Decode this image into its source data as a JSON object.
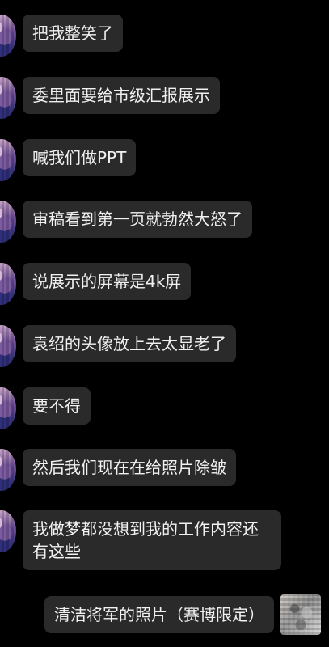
{
  "messages": [
    {
      "text": "把我整笑了",
      "side": "left"
    },
    {
      "text": "委里面要给市级汇报展示",
      "side": "left"
    },
    {
      "text": "喊我们做PPT",
      "side": "left"
    },
    {
      "text": "审稿看到第一页就勃然大怒了",
      "side": "left"
    },
    {
      "text": "说展示的屏幕是4k屏",
      "side": "left"
    },
    {
      "text": "袁绍的头像放上去太显老了",
      "side": "left"
    },
    {
      "text": "要不得",
      "side": "left"
    },
    {
      "text": "然后我们现在在给照片除皱",
      "side": "left"
    },
    {
      "text": "我做梦都没想到我的工作内容还有这些",
      "side": "left"
    },
    {
      "text": "清洁将军的照片（赛博限定）",
      "side": "right"
    }
  ],
  "colors": {
    "background": "#000000",
    "bubble": "#2a2a2a",
    "text": "#f1f1f1"
  }
}
